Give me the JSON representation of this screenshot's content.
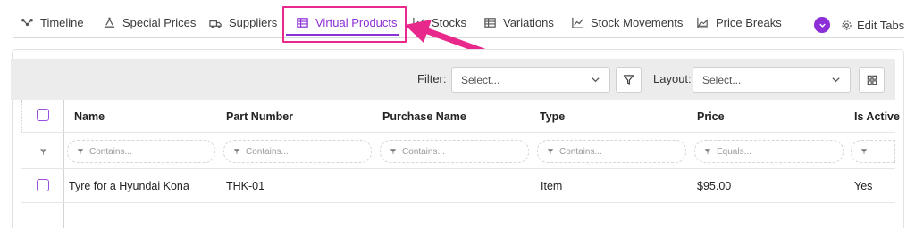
{
  "tabs": [
    {
      "label": "Timeline",
      "icon": "timeline-icon",
      "active": false
    },
    {
      "label": "Special Prices",
      "icon": "special-prices-icon",
      "active": false
    },
    {
      "label": "Suppliers",
      "icon": "suppliers-icon",
      "active": false
    },
    {
      "label": "Virtual Products",
      "icon": "table-icon",
      "active": true
    },
    {
      "label": "Stocks",
      "icon": "chart-line-icon",
      "active": false
    },
    {
      "label": "Variations",
      "icon": "table-icon",
      "active": false
    },
    {
      "label": "Stock Movements",
      "icon": "chart-line-icon",
      "active": false
    },
    {
      "label": "Price Breaks",
      "icon": "chart-area-icon",
      "active": false
    }
  ],
  "edit_tabs_label": "Edit Tabs",
  "toolbar": {
    "filter_label": "Filter:",
    "filter_select_value": "Select...",
    "layout_label": "Layout:",
    "layout_select_value": "Select..."
  },
  "table": {
    "columns": [
      "Name",
      "Part Number",
      "Purchase Name",
      "Type",
      "Price",
      "Is Active"
    ],
    "filter_placeholders": [
      "Contains...",
      "Contains...",
      "Contains...",
      "Contains...",
      "Equals...",
      ""
    ],
    "rows": [
      {
        "name": "Tyre for a Hyundai Kona",
        "part_number": "THK-01",
        "purchase_name": "",
        "type": "Item",
        "price": "$95.00",
        "is_active": "Yes"
      }
    ]
  },
  "colors": {
    "accent": "#8c2fd6",
    "annotation": "#e8288a",
    "toolbar_bg": "#ececec"
  }
}
